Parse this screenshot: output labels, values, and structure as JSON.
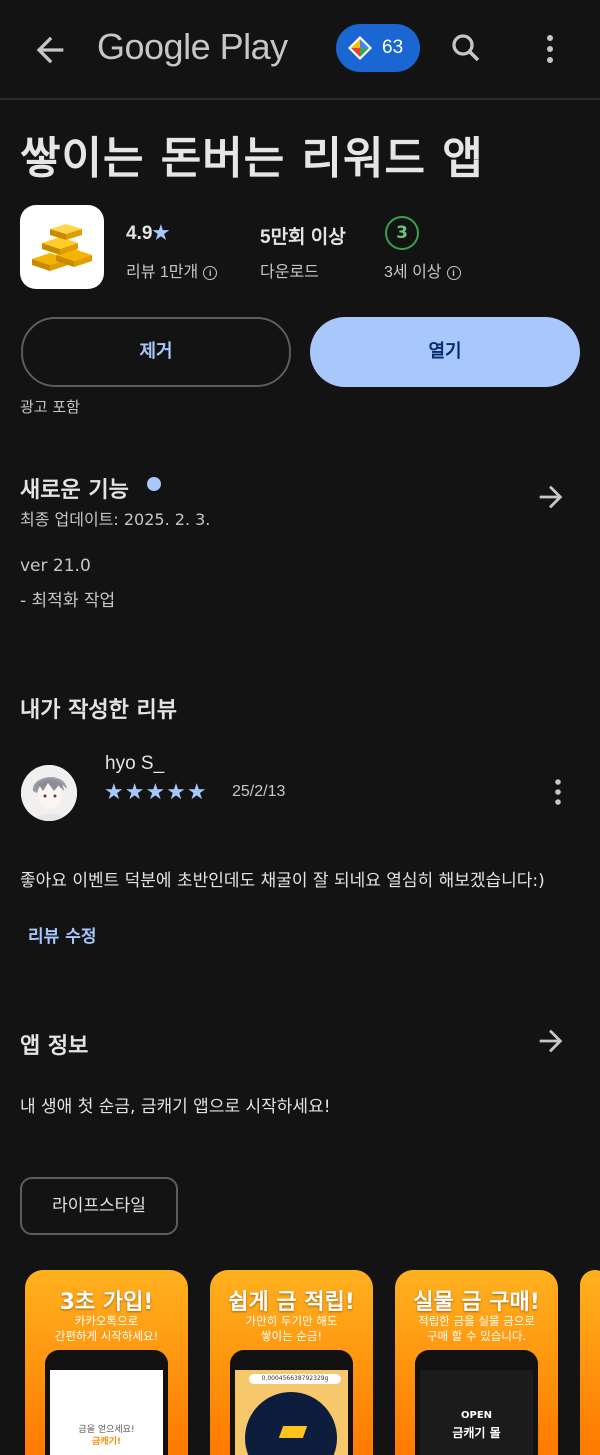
{
  "topbar": {
    "store_title": "Google Play",
    "points": "63"
  },
  "app": {
    "title": "쌓이는 돈버는 리워드 앱",
    "rating": "4.9",
    "rating_star": "★",
    "reviews_label": "리뷰 1만개",
    "downloads": "5만회 이상",
    "downloads_label": "다운로드",
    "age_rating": "3",
    "age_label": "3세 이상",
    "info_glyph": "i"
  },
  "actions": {
    "remove": "제거",
    "open": "열기",
    "ads_notice": "광고 포함"
  },
  "whats_new": {
    "heading": "새로운 기능",
    "updated": "최종 업데이트: 2025. 2. 3.",
    "version": "ver 21.0",
    "notes": "- 최적화 작업"
  },
  "my_review": {
    "heading": "내가 작성한 리뷰",
    "reviewer": "hyo S_",
    "stars": "★★★★★",
    "date": "25/2/13",
    "text": "좋아요 이벤트 덕분에 초반인데도 채굴이 잘 되네요 열심히 해보겠습니다:)",
    "edit": "리뷰 수정"
  },
  "about": {
    "heading": "앱 정보",
    "description": "내 생애 첫 순금, 금캐기 앱으로 시작하세요!",
    "category": "라이프스타일"
  },
  "screenshots": [
    {
      "headline": "3초 가입!",
      "sub1": "카카오톡으로",
      "sub2": "간편하게 시작하세요!",
      "screen1": "금을 얻으세요!",
      "screen2": "금캐기!"
    },
    {
      "headline": "쉽게 금 적립!",
      "sub1": "가만히 두기만 해도",
      "sub2": "쌓이는 순금!",
      "screen1": "0.000456638792329g"
    },
    {
      "headline": "실물 금 구매!",
      "sub1": "적립한 금을 실물 금으로",
      "sub2": "구매 할 수 있습니다.",
      "screen1": "OPEN",
      "screen2": "금캐기 몰"
    }
  ],
  "colors": {
    "accent": "#a8c7fa",
    "background": "#131313",
    "points_badge": "#1a66d2",
    "age_green": "#38a150"
  }
}
